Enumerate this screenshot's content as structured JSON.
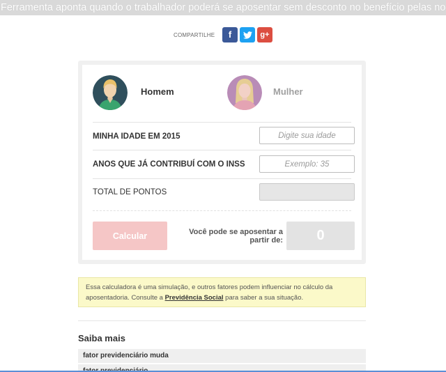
{
  "headline": "Ferramenta aponta quando o trabalhador poderá se aposentar sem desconto no benefício pelas novas regras.",
  "share": {
    "label": "COMPARTILHE",
    "facebook_glyph": "f",
    "twitter_glyph": "t",
    "googleplus_glyph": "g+"
  },
  "calculator": {
    "gender": {
      "male_label": "Homem",
      "female_label": "Mulher",
      "selected": "Homem"
    },
    "age": {
      "label": "MINHA IDADE EM 2015",
      "placeholder": "Digite sua idade"
    },
    "contribution": {
      "label": "ANOS QUE JÁ CONTRIBUÍ COM O INSS",
      "placeholder": "Exemplo: 35"
    },
    "points": {
      "label": "TOTAL DE PONTOS"
    },
    "calculate_button": "Calcular",
    "result_label": "Você pode se aposentar a partir de:",
    "result_value": "0"
  },
  "notice": {
    "text_before": "Essa calculadora é uma simulação, e outros fatores podem influenciar no cálculo da aposentadoria. Consulte a ",
    "link": "Previdência Social",
    "text_after": " para saber a sua situação."
  },
  "saiba_mais": {
    "title": "Saiba mais",
    "items": [
      "fator previdenciário muda",
      "fator previdenciário"
    ]
  },
  "colors": {
    "male_ring": "#2f4f5c",
    "female_ring": "#b98cb7",
    "button": "#f5c6c6",
    "notice_bg": "#fbf9c9"
  }
}
